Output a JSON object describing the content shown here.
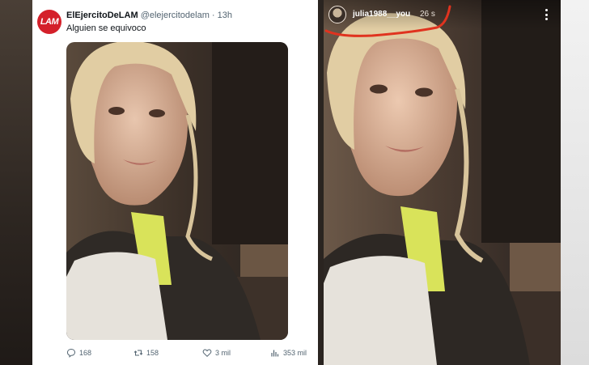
{
  "tweet": {
    "avatar_text": "LAM",
    "display_name": "ElEjercitoDeLAM",
    "handle": "@elejercitodelam",
    "separator": "·",
    "time": "13h",
    "text": "Alguien se equivoco",
    "actions": {
      "replies": "168",
      "retweets": "158",
      "likes": "3 mil",
      "views": "353 mil"
    }
  },
  "story": {
    "username": "julia1988__you",
    "time": "26 s"
  },
  "colors": {
    "annotation": "#e0331f",
    "lam_brand": "#d4202a",
    "jacket_yellow": "#d9e35a"
  }
}
